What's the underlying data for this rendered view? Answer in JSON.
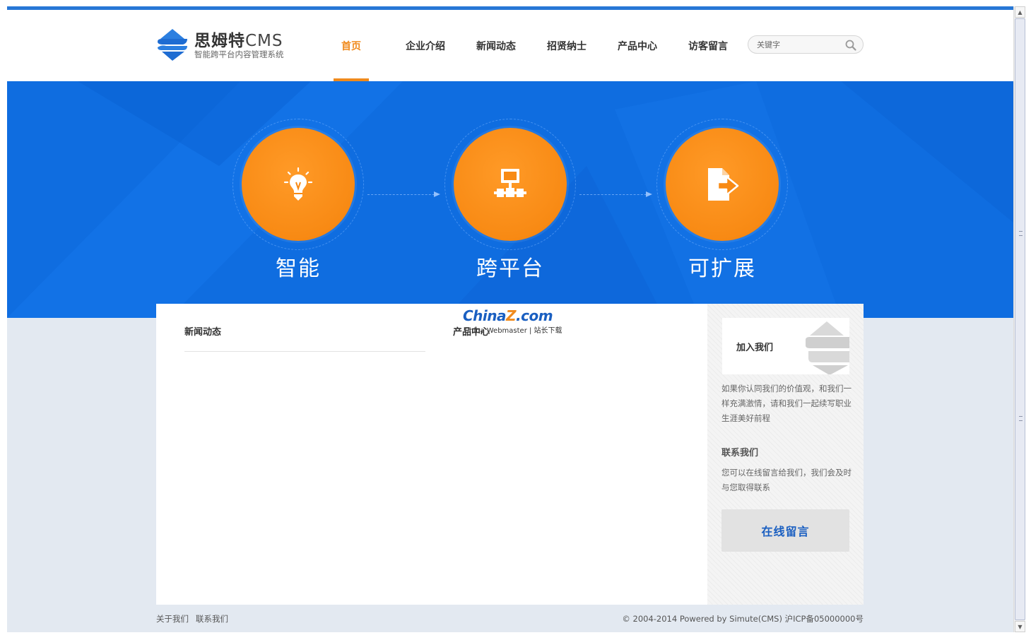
{
  "brand": {
    "name": "思姆特",
    "name_suffix": "CMS",
    "tagline": "智能跨平台内容管理系统"
  },
  "nav": {
    "items": [
      {
        "label": "首页",
        "active": true
      },
      {
        "label": "企业介绍",
        "active": false
      },
      {
        "label": "新闻动态",
        "active": false
      },
      {
        "label": "招贤纳士",
        "active": false
      },
      {
        "label": "产品中心",
        "active": false
      },
      {
        "label": "访客留言",
        "active": false
      }
    ]
  },
  "search": {
    "placeholder": "关键字",
    "icon": "search-icon"
  },
  "banner": {
    "features": [
      {
        "label": "智能",
        "icon": "lightbulb-icon"
      },
      {
        "label": "跨平台",
        "icon": "network-icon"
      },
      {
        "label": "可扩展",
        "icon": "document-export-icon"
      }
    ]
  },
  "content": {
    "news_title": "新闻动态",
    "product_title": "产品中心"
  },
  "watermark": {
    "logo_main": "China",
    "logo_z": "Z",
    "logo_suffix": ".com",
    "subtitle": "China Webmaster | 站长下载"
  },
  "sidebar": {
    "join_title": "加入我们",
    "join_text": "如果你认同我们的价值观，和我们一样充满激情，请和我们一起续写职业生涯美好前程",
    "contact_title": "联系我们",
    "contact_text": "您可以在线留言给我们，我们会及时与您取得联系",
    "message_button": "在线留言"
  },
  "footer": {
    "links": [
      "关于我们",
      "联系我们"
    ],
    "copyright": "© 2004-2014 Powered by Simute(CMS)  沪ICP备05000000号"
  },
  "colors": {
    "accent_orange": "#f08a1c",
    "banner_blue": "#0f6de0",
    "page_bg": "#e3e9f1",
    "link_blue": "#1a5fc1"
  }
}
